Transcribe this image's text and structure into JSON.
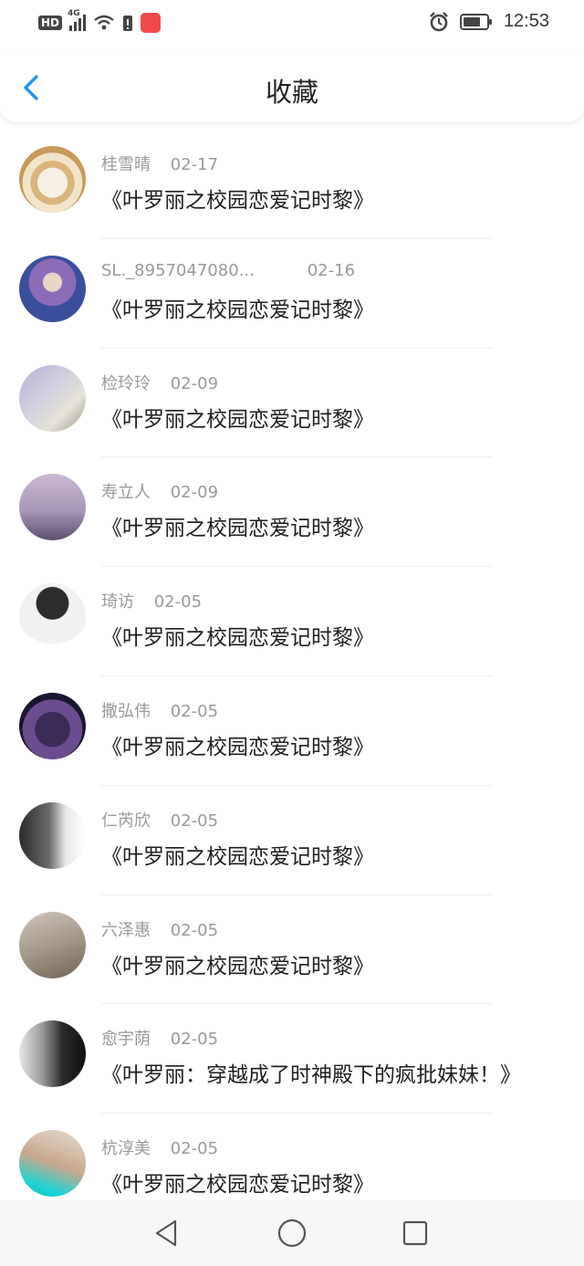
{
  "statusbar": {
    "hd_label": "HD",
    "network_label": "4G",
    "time": "12:53",
    "icons": [
      "hd-icon",
      "signal-icon",
      "wifi-icon",
      "battery-alert-icon",
      "app-notification-icon",
      "alarm-icon",
      "battery-icon"
    ]
  },
  "header": {
    "title": "收藏",
    "back_icon": "chevron-left-icon"
  },
  "items": [
    {
      "name": "桂雪晴",
      "date": "02-17",
      "book": "《叶罗丽之校园恋爱记时黎》",
      "avatar": "cat-avatar"
    },
    {
      "name": "SL._8957047080...",
      "date": "02-16",
      "book": "《叶罗丽之校园恋爱记时黎》",
      "avatar": "fantasy-avatar"
    },
    {
      "name": "检玲玲",
      "date": "02-09",
      "book": "《叶罗丽之校园恋爱记时黎》",
      "avatar": "flowers-avatar"
    },
    {
      "name": "寿立人",
      "date": "02-09",
      "book": "《叶罗丽之校园恋爱记时黎》",
      "avatar": "couple-avatar"
    },
    {
      "name": "琦访",
      "date": "02-05",
      "book": "《叶罗丽之校园恋爱记时黎》",
      "avatar": "sketch-avatar"
    },
    {
      "name": "撒弘伟",
      "date": "02-05",
      "book": "《叶罗丽之校园恋爱记时黎》",
      "avatar": "jersey-avatar"
    },
    {
      "name": "仁芮欣",
      "date": "02-05",
      "book": "《叶罗丽之校园恋爱记时黎》",
      "avatar": "bw-portrait-avatar"
    },
    {
      "name": "六泽惠",
      "date": "02-05",
      "book": "《叶罗丽之校园恋爱记时黎》",
      "avatar": "phone-selfie-avatar"
    },
    {
      "name": "愈宇荫",
      "date": "02-05",
      "book": "《叶罗丽：穿越成了时神殿下的疯批妹妹！》",
      "avatar": "dark-portrait-avatar"
    },
    {
      "name": "杭淳美",
      "date": "02-05",
      "book": "《叶罗丽之校园恋爱记时黎》",
      "avatar": "girl-cyan-avatar"
    }
  ],
  "navbar": {
    "back": "triangle-back-icon",
    "home": "circle-home-icon",
    "recent": "square-recents-icon"
  }
}
